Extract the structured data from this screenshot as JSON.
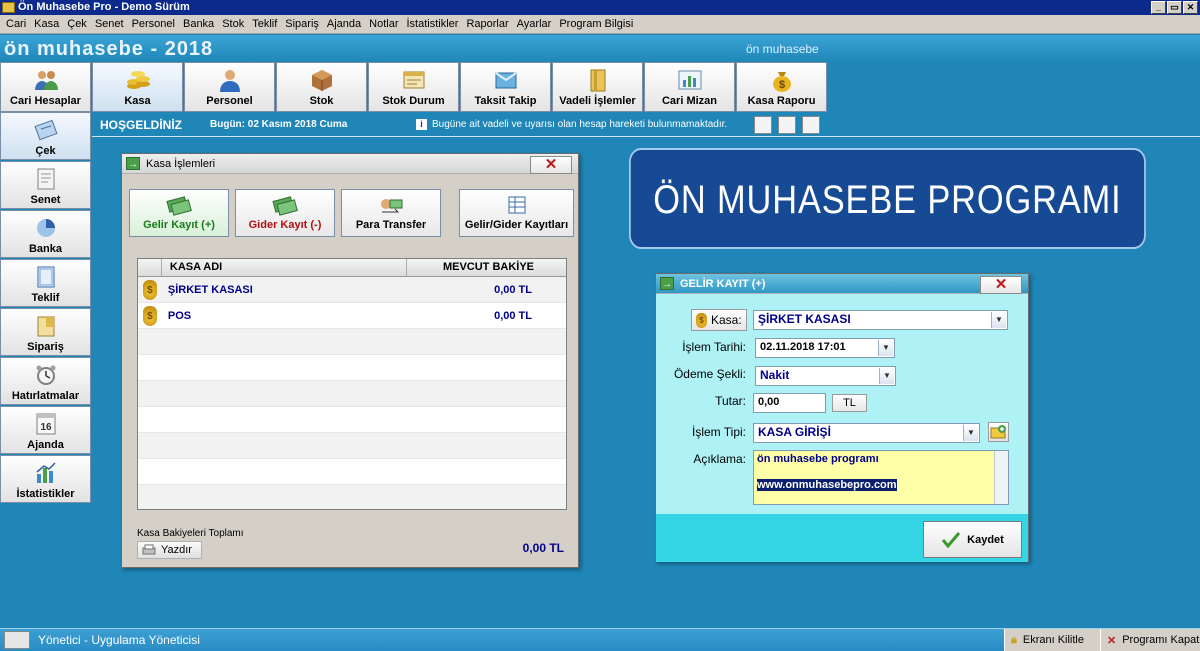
{
  "window": {
    "title": "Ön Muhasebe Pro - Demo Sürüm",
    "buttons": [
      "_",
      "▭",
      "✕"
    ]
  },
  "menu": [
    "Cari",
    "Kasa",
    "Çek",
    "Senet",
    "Personel",
    "Banka",
    "Stok",
    "Teklif",
    "Sipariş",
    "Ajanda",
    "Notlar",
    "İstatistikler",
    "Raporlar",
    "Ayarlar",
    "Program Bilgisi"
  ],
  "header": {
    "title": "ön muhasebe - 2018",
    "subtitle": "ön muhasebe"
  },
  "toolbar": [
    {
      "label": "Cari Hesaplar",
      "icon": "users-icon"
    },
    {
      "label": "Kasa",
      "icon": "coins-icon"
    },
    {
      "label": "Personel",
      "icon": "person-icon"
    },
    {
      "label": "Stok",
      "icon": "box-icon"
    },
    {
      "label": "Stok Durum",
      "icon": "stock-status-icon"
    },
    {
      "label": "Taksit Takip",
      "icon": "installment-icon"
    },
    {
      "label": "Vadeli İşlemler",
      "icon": "folder-icon"
    },
    {
      "label": "Cari Mizan",
      "icon": "mizan-chart-icon"
    },
    {
      "label": "Kasa Raporu",
      "icon": "money-bag-icon"
    }
  ],
  "sidebar": [
    {
      "label": "Çek",
      "icon": "check-icon"
    },
    {
      "label": "Senet",
      "icon": "note-icon"
    },
    {
      "label": "Banka",
      "icon": "bank-pie-icon"
    },
    {
      "label": "Teklif",
      "icon": "offer-icon"
    },
    {
      "label": "Sipariş",
      "icon": "order-icon"
    },
    {
      "label": "Hatırlatmalar",
      "icon": "alarm-clock-icon"
    },
    {
      "label": "Ajanda",
      "icon": "calendar-icon"
    },
    {
      "label": "İstatistikler",
      "icon": "bar-chart-icon"
    }
  ],
  "welcome": {
    "hello": "HOŞGELDİNİZ",
    "today": "Bugün: 02 Kasım 2018 Cuma",
    "notice": "Bugüne ait vadeli ve uyarısı olan hesap hareketi bulunmamaktadır."
  },
  "kasa": {
    "title": "Kasa İşlemleri",
    "buttons": {
      "gelir": "Gelir Kayıt (+)",
      "gider": "Gider Kayıt (-)",
      "transfer": "Para Transfer",
      "kayitlar": "Gelir/Gider Kayıtları"
    },
    "columns": {
      "name": "KASA ADI",
      "balance": "MEVCUT BAKİYE"
    },
    "rows": [
      {
        "name": "ŞİRKET KASASI",
        "balance": "0,00 TL"
      },
      {
        "name": "POS",
        "balance": "0,00 TL"
      }
    ],
    "total_label": "Kasa Bakiyeleri Toplamı",
    "print_label": "Yazdır",
    "total": "0,00 TL"
  },
  "banner": "ÖN MUHASEBE PROGRAMI",
  "gelir": {
    "title": "GELİR KAYIT (+)",
    "kasa_label": "Kasa:",
    "kasa_value": "ŞİRKET KASASI",
    "date_label": "İşlem Tarihi:",
    "date_value": "02.11.2018 17:01",
    "payment_label": "Ödeme Şekli:",
    "payment_value": "Nakit",
    "amount_label": "Tutar:",
    "amount_value": "0,00",
    "currency": "TL",
    "type_label": "İşlem Tipi:",
    "type_value": "KASA GİRİŞİ",
    "desc_label": "Açıklama:",
    "desc_line1": "ön muhasebe programı",
    "desc_line2": "www.onmuhasebepro.com",
    "save_label": "Kaydet"
  },
  "status": {
    "user": "Yönetici - Uygulama Yöneticisi",
    "lock": "Ekranı Kilitle",
    "close": "Programı Kapat"
  }
}
